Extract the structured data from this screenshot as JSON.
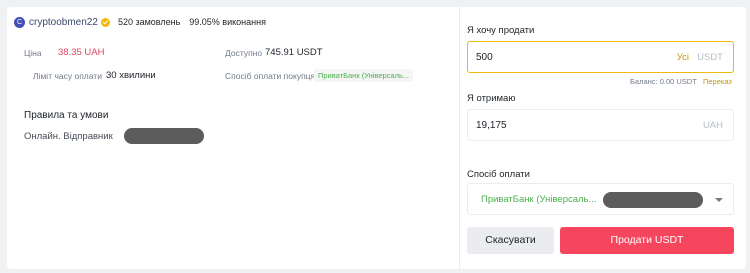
{
  "merchant": {
    "avatar_letter": "C",
    "name": "cryptoobmen22",
    "orders": "520 замовлень",
    "completion": "99.05% виконання"
  },
  "details": {
    "price_label": "Ціна",
    "price_value": "38.35 UAH",
    "available_label": "Доступно",
    "available_value": "745.91 USDT",
    "time_limit_label": "Ліміт часу оплати",
    "time_limit_value": "30 хвилини",
    "buyer_payment_label": "Спосіб оплати покупця",
    "buyer_payment_value": "ПриватБанк (Універсаль..."
  },
  "terms": {
    "title": "Правила та умови",
    "text": "Онлайн. Відправник"
  },
  "sell_form": {
    "sell_label": "Я хочу продати",
    "sell_value": "500",
    "all_link": "Усі",
    "sell_unit": "USDT",
    "balance": "Баланс: 0.00 USDT",
    "transfer_link": "Переказ",
    "receive_label": "Я отримаю",
    "receive_value": "19,175",
    "receive_unit": "UAH",
    "payment_label": "Спосіб оплати",
    "payment_selected": "ПриватБанк (Універсаль...",
    "cancel_button": "Скасувати",
    "sell_button": "Продати USDT"
  },
  "colors": {
    "accent": "#f0b90b",
    "price": "#e0435b",
    "sell_button": "#f6465d",
    "payment_green": "#4caf50"
  }
}
